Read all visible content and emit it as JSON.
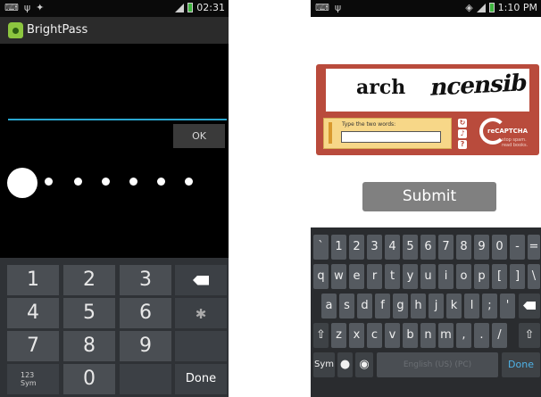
{
  "left": {
    "status_time": "02:31",
    "app_title": "BrightPass",
    "ok_label": "OK",
    "numpad": {
      "rows": [
        [
          "1",
          "2",
          "3"
        ],
        [
          "4",
          "5",
          "6"
        ],
        [
          "7",
          "8",
          "9"
        ]
      ],
      "sym_label": "123",
      "sym_sub": "Sym",
      "zero": "0",
      "done_label": "Done"
    }
  },
  "right": {
    "status_time": "1:10 PM",
    "captcha": {
      "word1": "arch",
      "word2": "ncensib",
      "instruction": "Type the two words:",
      "brand": "reCAPTCHA",
      "tagline_1": "stop spam.",
      "tagline_2": "read books."
    },
    "submit_label": "Submit",
    "keyboard": {
      "row1": [
        "`",
        "1",
        "2",
        "3",
        "4",
        "5",
        "6",
        "7",
        "8",
        "9",
        "0",
        "-",
        "="
      ],
      "row2": [
        "q",
        "w",
        "e",
        "r",
        "t",
        "y",
        "u",
        "i",
        "o",
        "p",
        "[",
        "]",
        "\\"
      ],
      "row3": [
        "a",
        "s",
        "d",
        "f",
        "g",
        "h",
        "j",
        "k",
        "l",
        ";",
        "'"
      ],
      "row4": [
        "z",
        "x",
        "c",
        "v",
        "b",
        "n",
        "m",
        ",",
        ".",
        "/"
      ],
      "sym_label": "Sym",
      "space_label": "English (US) (PC)",
      "done_label": "Done"
    }
  },
  "icons": [
    "usb-icon",
    "signal-icon",
    "battery-icon",
    "wifi-icon",
    "backspace-icon",
    "settings-icon",
    "shift-icon",
    "mic-icon",
    "globe-icon",
    "refresh-icon",
    "audio-icon",
    "help-icon"
  ],
  "colors": {
    "accent_blue": "#2aa6cf",
    "captcha_red": "#b94b3c",
    "android_green": "#8cc63f"
  }
}
